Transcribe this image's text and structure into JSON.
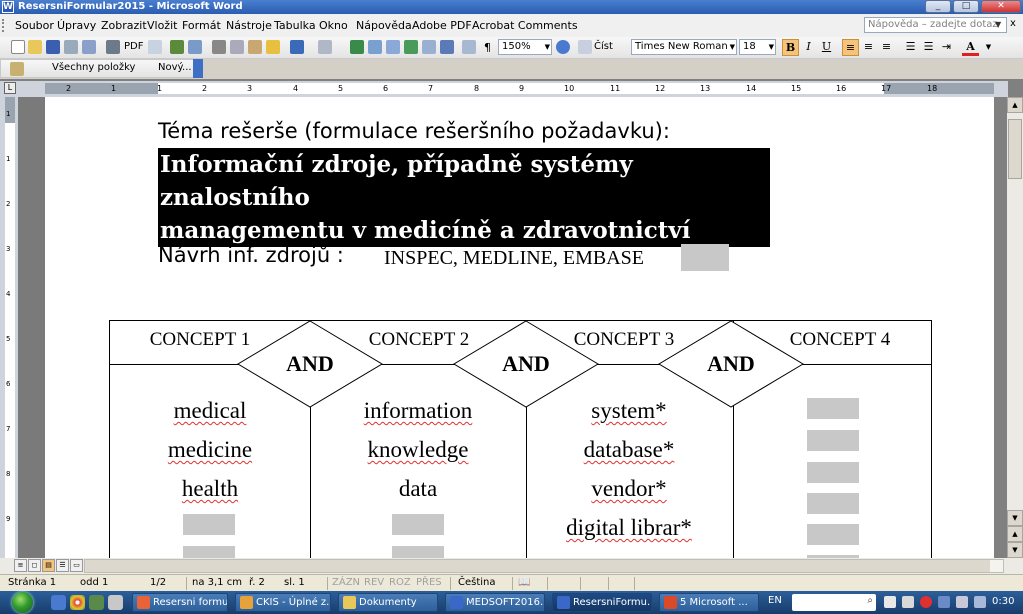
{
  "window": {
    "title": "ResersniFormular2015 - Microsoft Word",
    "app_icon_letter": "W",
    "controls": [
      "_",
      "□",
      "✕"
    ]
  },
  "menubar": {
    "items": [
      "Soubor",
      "Úpravy",
      "Zobrazit",
      "Vložit",
      "Formát",
      "Nástroje",
      "Tabulka",
      "Okno",
      "Nápověda",
      "Adobe PDF",
      "Acrobat Comments"
    ],
    "help_placeholder": "Nápověda – zadejte dotaz",
    "close_glyph": "x"
  },
  "toolbar": {
    "pdf_label": "PDF",
    "zoom": "150%",
    "read_label": "Číst",
    "font": "Times New Roman",
    "font_size": "18",
    "bold": "B",
    "italic": "I",
    "underline": "U",
    "paragraph_mark": "¶",
    "font_color_glyph": "A"
  },
  "toolbar2": {
    "all_items": "Všechny položky",
    "new_item": "Nový..."
  },
  "ruler": {
    "tab_selector": "L",
    "top_numbers": [
      "2",
      "1",
      "1",
      "2",
      "3",
      "4",
      "5",
      "6",
      "7",
      "8",
      "9",
      "10",
      "11",
      "12",
      "13",
      "14",
      "15",
      "16",
      "17",
      "18"
    ],
    "left_numbers": [
      "1",
      "1",
      "2",
      "3",
      "4",
      "5",
      "6",
      "7",
      "8",
      "9",
      "10"
    ]
  },
  "document": {
    "theme_label": "Téma rešerše (formulace rešeršního požadavku):",
    "theme_line1": "Informační zdroje, případně systémy znalostního",
    "theme_line2": "managementu v medicíně a zdravotnictví",
    "sources_label": "Návrh inf. zdrojů :",
    "sources_value": "INSPEC, MEDLINE, EMBASE",
    "concepts": [
      {
        "header": "CONCEPT 1",
        "terms": [
          "medical",
          "medicine",
          "health"
        ]
      },
      {
        "header": "CONCEPT 2",
        "terms": [
          "information",
          "knowledge",
          "data"
        ]
      },
      {
        "header": "CONCEPT 3",
        "terms": [
          "system*",
          "database*",
          "vendor*",
          "digital librar*"
        ]
      },
      {
        "header": "CONCEPT 4",
        "terms": []
      }
    ],
    "operators": [
      "AND",
      "AND",
      "AND"
    ]
  },
  "statusbar": {
    "page": "Stránka 1",
    "section": "odd 1",
    "pages": "1/2",
    "position": "na 3,1 cm",
    "line": "ř. 2",
    "column": "sl. 1",
    "rec": "ZÁZN",
    "rev": "REV",
    "ext": "ROZ",
    "ovr": "PŘES",
    "language": "Čeština"
  },
  "taskbar": {
    "tasks": [
      {
        "label": "Resersni formul...",
        "color": "#e8623a"
      },
      {
        "label": "CKIS - Úplné z...",
        "color": "#e8a23a"
      },
      {
        "label": "Dokumenty",
        "color": "#e8c85a"
      },
      {
        "label": "MEDSOFT2016...",
        "color": "#3a68c8"
      },
      {
        "label": "ResersniFormu...",
        "color": "#3a68c8"
      },
      {
        "label": "5 Microsoft ...",
        "color": "#d84a2a"
      }
    ],
    "language": "EN",
    "clock": "0:30"
  },
  "colors": {
    "titlebar": "#2a5cb0",
    "highlight_bg": "#000000",
    "form_field": "#c8c8c8",
    "active_format": "#f6c37a"
  }
}
